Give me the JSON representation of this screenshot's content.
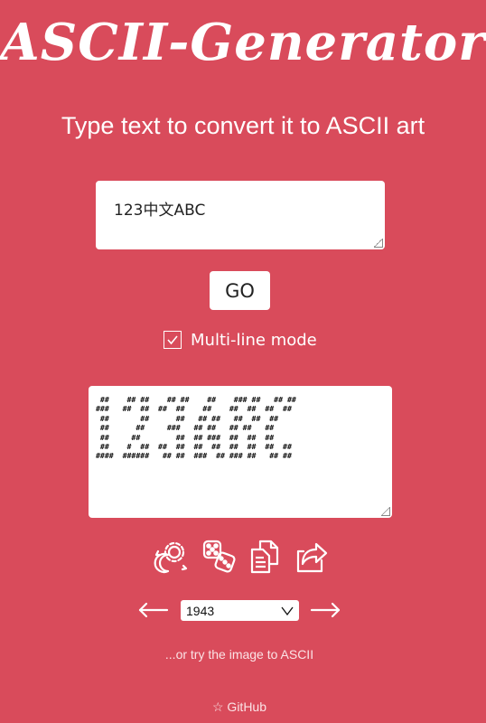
{
  "header": {
    "title": "ASCII-Generator",
    "subtitle": "Type text to convert it to ASCII art"
  },
  "input": {
    "value": "123中文ABC"
  },
  "actions": {
    "go_label": "GO",
    "multiline_label": "Multi-line mode",
    "multiline_checked": true
  },
  "output": {
    "ascii": " ##    ## ##    ## ##    ##    ### ##   ## ##\n###   ##  ##  ##  ##    ##    ##  ##  ##  ##\n ##       ##      ##   ## ##   ##  ##  ##\n ##      ##     ###   ## ##   ## ##   ##\n ##     ##        ##  ## ###  ##  ##  ##\n ##    #  ##  ##  ##  ##  ##  ##  ##  ##  ##\n####  ######   ## ##  ###  ## ### ##   ## ##"
  },
  "toolbar": {
    "icons": [
      "randomize-icon",
      "dice-icon",
      "copy-icon",
      "share-icon"
    ]
  },
  "font_select": {
    "selected": "1943"
  },
  "footer": {
    "image_link": "...or try the image to ASCII",
    "github_label": "☆ GitHub"
  },
  "colors": {
    "background": "#d94b5b",
    "surface": "#ffffff"
  }
}
